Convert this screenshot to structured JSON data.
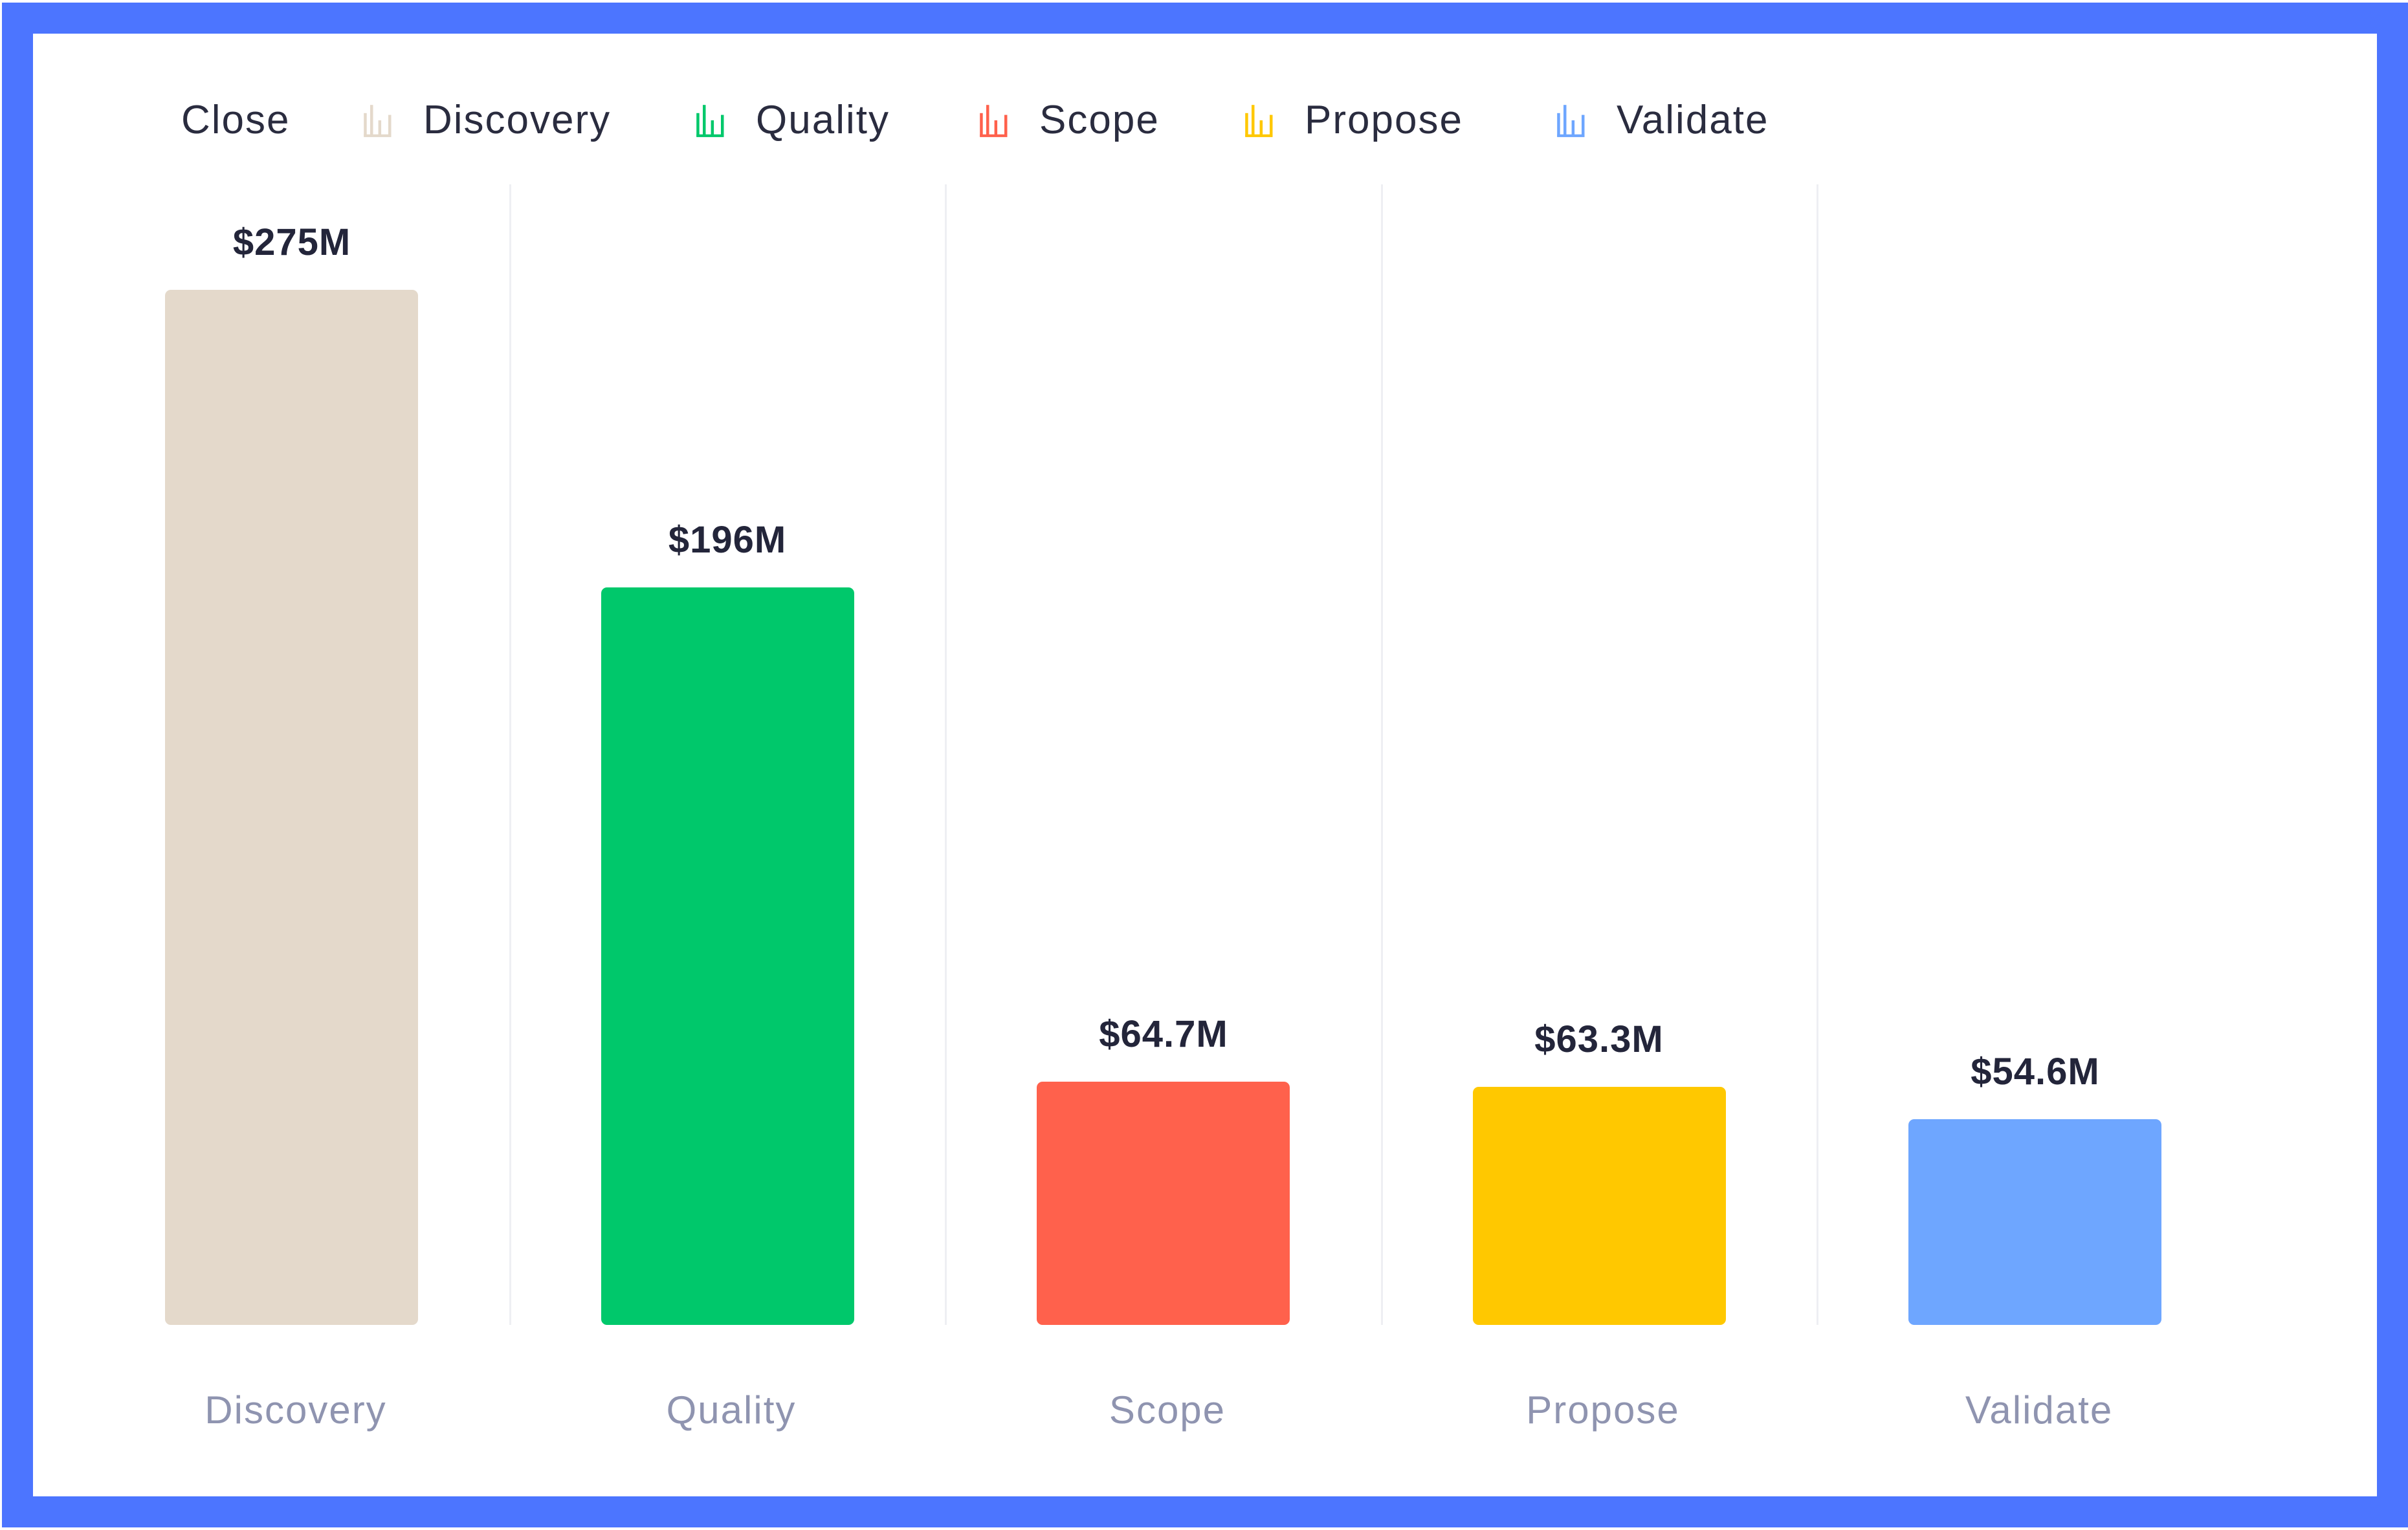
{
  "chart_data": {
    "type": "bar",
    "title": "",
    "xlabel": "",
    "ylabel": "",
    "ylim": [
      0,
      275
    ],
    "grid": false,
    "legend_position": "top-left",
    "legend": [
      {
        "label": "Close",
        "color": null,
        "icon": null
      },
      {
        "label": "Discovery",
        "color": "#E4D9CB",
        "icon": "bar-chart-icon"
      },
      {
        "label": "Quality",
        "color": "#00C86B",
        "icon": "bar-chart-icon"
      },
      {
        "label": "Scope",
        "color": "#FF614C",
        "icon": "bar-chart-icon"
      },
      {
        "label": "Propose",
        "color": "#FFC800",
        "icon": "bar-chart-icon"
      },
      {
        "label": "Validate",
        "color": "#6EA6FF",
        "icon": "bar-chart-icon"
      }
    ],
    "categories": [
      "Discovery",
      "Quality",
      "Scope",
      "Propose",
      "Validate"
    ],
    "values": [
      275,
      196,
      64.7,
      63.3,
      54.6
    ],
    "value_unit": "$M",
    "data_labels": [
      "$275M",
      "$196M",
      "$64.7M",
      "$63.3M",
      "$54.6M"
    ],
    "colors": [
      "#E4D9CB",
      "#00C86B",
      "#FF614C",
      "#FFC800",
      "#6EA6FF"
    ]
  },
  "frame_color": "#4C75FF"
}
